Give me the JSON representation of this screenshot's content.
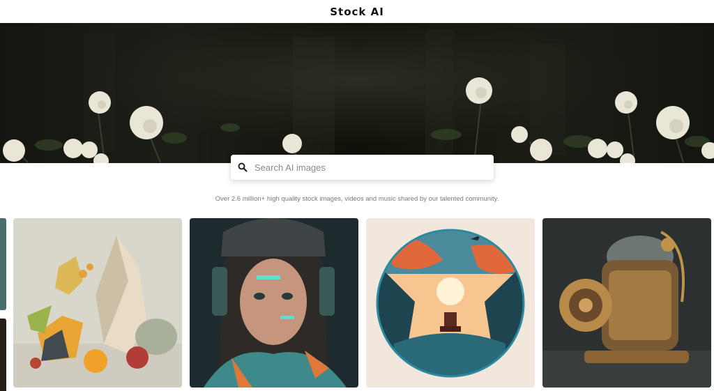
{
  "app": {
    "title": "Stock AI"
  },
  "search": {
    "placeholder": "Search AI images"
  },
  "tagline": "Over 2.6 million+ high quality stock images, videos and music shared by our talented community.",
  "colors": {
    "background": "#ffffff",
    "hero_dark": "#14150f",
    "text_muted": "#7a7a7a"
  },
  "icons": {
    "search": "search-icon"
  }
}
